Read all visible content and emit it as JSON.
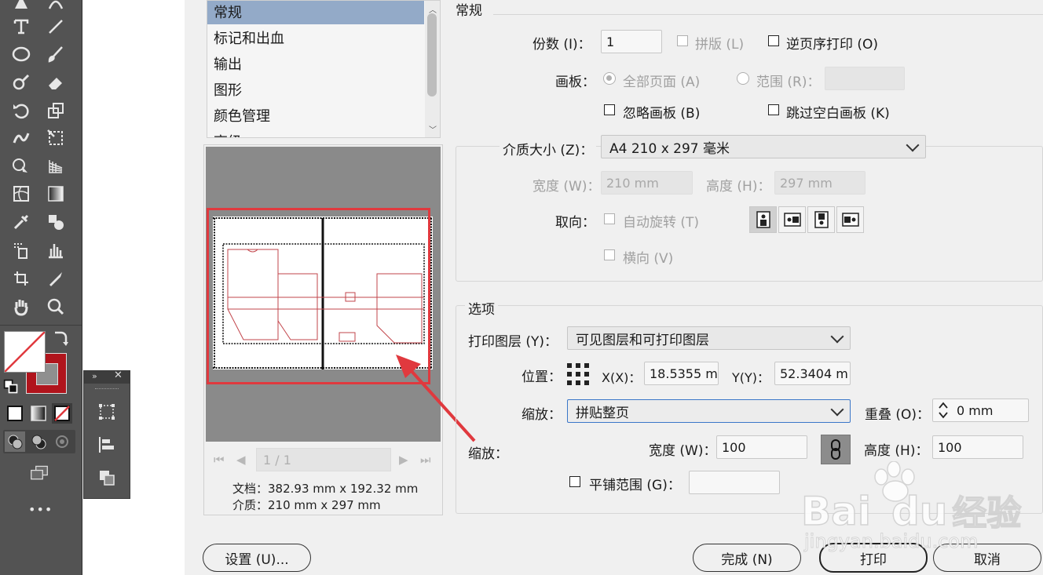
{
  "dialog": {
    "categories": [
      "常规",
      "标记和出血",
      "输出",
      "图形",
      "颜色管理",
      "高级"
    ],
    "selected_category": "常规",
    "section_title": "常规",
    "copies": {
      "label": "份数 (I)：",
      "value": "1"
    },
    "collate": {
      "label": "拼版 (L)"
    },
    "reverse_order": {
      "label": "逆页序打印 (O)"
    },
    "artboards": {
      "label": "画板：",
      "all_pages": "全部页面 (A)",
      "range": "范围 (R)：",
      "range_value": ""
    },
    "ignore_artboards": {
      "label": "忽略画板 (B)"
    },
    "skip_blank": {
      "label": "跳过空白画板 (K)"
    },
    "media_size": {
      "label": "介质大小 (Z)：",
      "value": "A4 210 x 297 毫米"
    },
    "width": {
      "label": "宽度 (W)：",
      "value": "210 mm"
    },
    "height": {
      "label": "高度 (H)：",
      "value": "297 mm"
    },
    "orientation": {
      "label": "取向：",
      "auto_rotate": "自动旋转 (T)",
      "landscape": "横向 (V)"
    },
    "options_title": "选项",
    "print_layers": {
      "label": "打印图层 (Y)：",
      "value": "可见图层和可打印图层"
    },
    "position": {
      "label": "位置：",
      "x_label": "X(X)：",
      "x_value": "18.5355 m",
      "y_label": "Y(Y)：",
      "y_value": "52.3404 m"
    },
    "scaling": {
      "label": "缩放：",
      "value": "拼贴整页",
      "overlap_label": "重叠 (O)：",
      "overlap_value": "0 mm"
    },
    "scale": {
      "label": "缩放：",
      "width_label": "宽度 (W)：",
      "width_value": "100",
      "height_label": "高度 (H)：",
      "height_value": "100"
    },
    "tile_range": {
      "label": "平铺范围 (G)：",
      "value": ""
    },
    "pager": "1 / 1",
    "doc_info": "文档：382.93 mm x 192.32 mm",
    "media_info": "介质：210 mm x 297 mm",
    "buttons": {
      "setup": "设置 (U)...",
      "done": "完成 (N)",
      "print": "打印",
      "cancel": "取消"
    }
  },
  "watermark": {
    "brand_left": "Bai",
    "brand_right": "du",
    "brand_cn": "经验",
    "url": "jingyan.baidu.com"
  },
  "colors": {
    "toolbar_bg": "#535353",
    "selected_item": "#93aac8",
    "highlight_red": "#e0393e",
    "fill_red": "#b0141c"
  },
  "toolbar": {
    "icons": [
      "pen-icon",
      "type-icon",
      "line-icon",
      "ellipse-icon",
      "brush-icon",
      "shaper-icon",
      "eraser-icon",
      "rotate-icon",
      "scale-icon",
      "puppet-warp-icon",
      "free-transform-icon",
      "shape-builder-icon",
      "perspective-grid-icon",
      "mesh-icon",
      "gradient-icon",
      "eyedropper-icon",
      "blend-icon",
      "symbol-sprayer-icon",
      "column-graph-icon",
      "artboard-icon",
      "slice-icon",
      "hand-icon",
      "zoom-icon"
    ],
    "more_label": "•••"
  }
}
